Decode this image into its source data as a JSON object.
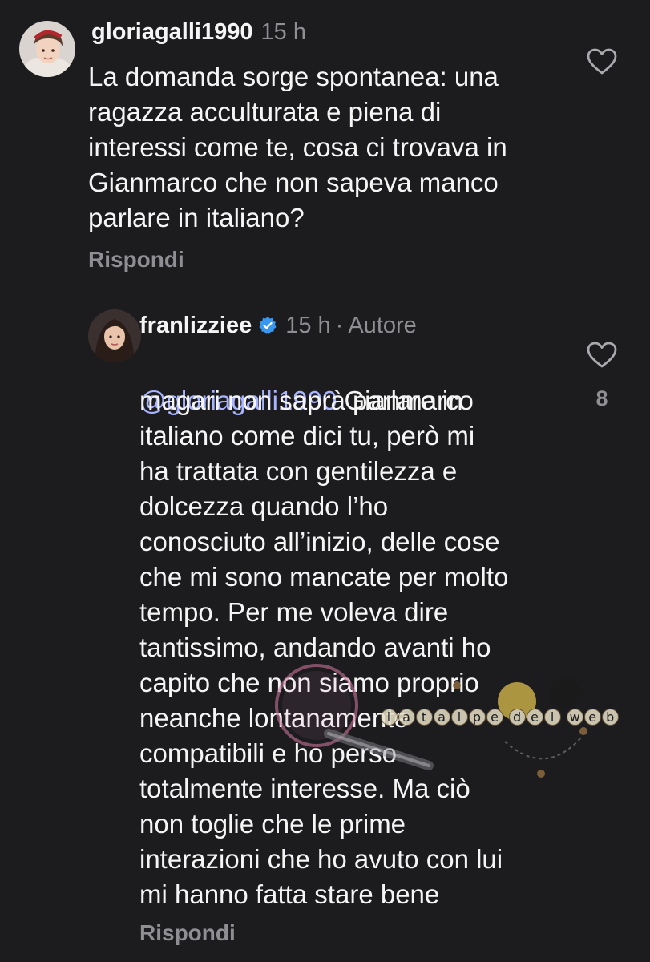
{
  "comment": {
    "username": "gloriagalli1990",
    "time": "15 h",
    "text": "La domanda sorge spontanea: una\nragazza acculturata e piena di\ninteressi come te, cosa ci trovava in\nGianmarco che non sapeva manco\nparlare in italiano?",
    "reply_label": "Rispondi"
  },
  "reply": {
    "username": "franlizziee",
    "time": "15 h",
    "separator": "·",
    "author_tag": "Autore",
    "mention": "@gloriagalli1990",
    "text_first_line": " Gianmarco",
    "text": "magari non saprà parlare in\nitaliano come dici tu, però mi\nha trattata con gentilezza e\ndolcezza quando l’ho\nconosciuto all’inizio, delle cose\nche mi sono mancate per molto\ntempo. Per me voleva dire\ntantissimo, andando avanti ho\ncapito che non siamo proprio\nneanche lontanamente\ncompatibili e ho perso\ntotalmente interesse. Ma ciò\nnon toglie che le prime\ninterazioni che ho avuto con lui\nmi hanno fatta stare bene",
    "like_count": "8",
    "reply_label": "Rispondi"
  },
  "watermark": {
    "letters": [
      "l",
      "a",
      "t",
      "a",
      "l",
      "p",
      "e",
      "d",
      "e",
      "l",
      "w",
      "e",
      "b"
    ]
  },
  "icons": {
    "like": "heart-outline-icon",
    "verified": "verified-badge-icon"
  },
  "colors": {
    "background": "#1c1c1f",
    "text": "#f5f5f5",
    "muted": "#8e8e93",
    "mention": "#a8b4ff",
    "verified": "#3897f0"
  }
}
